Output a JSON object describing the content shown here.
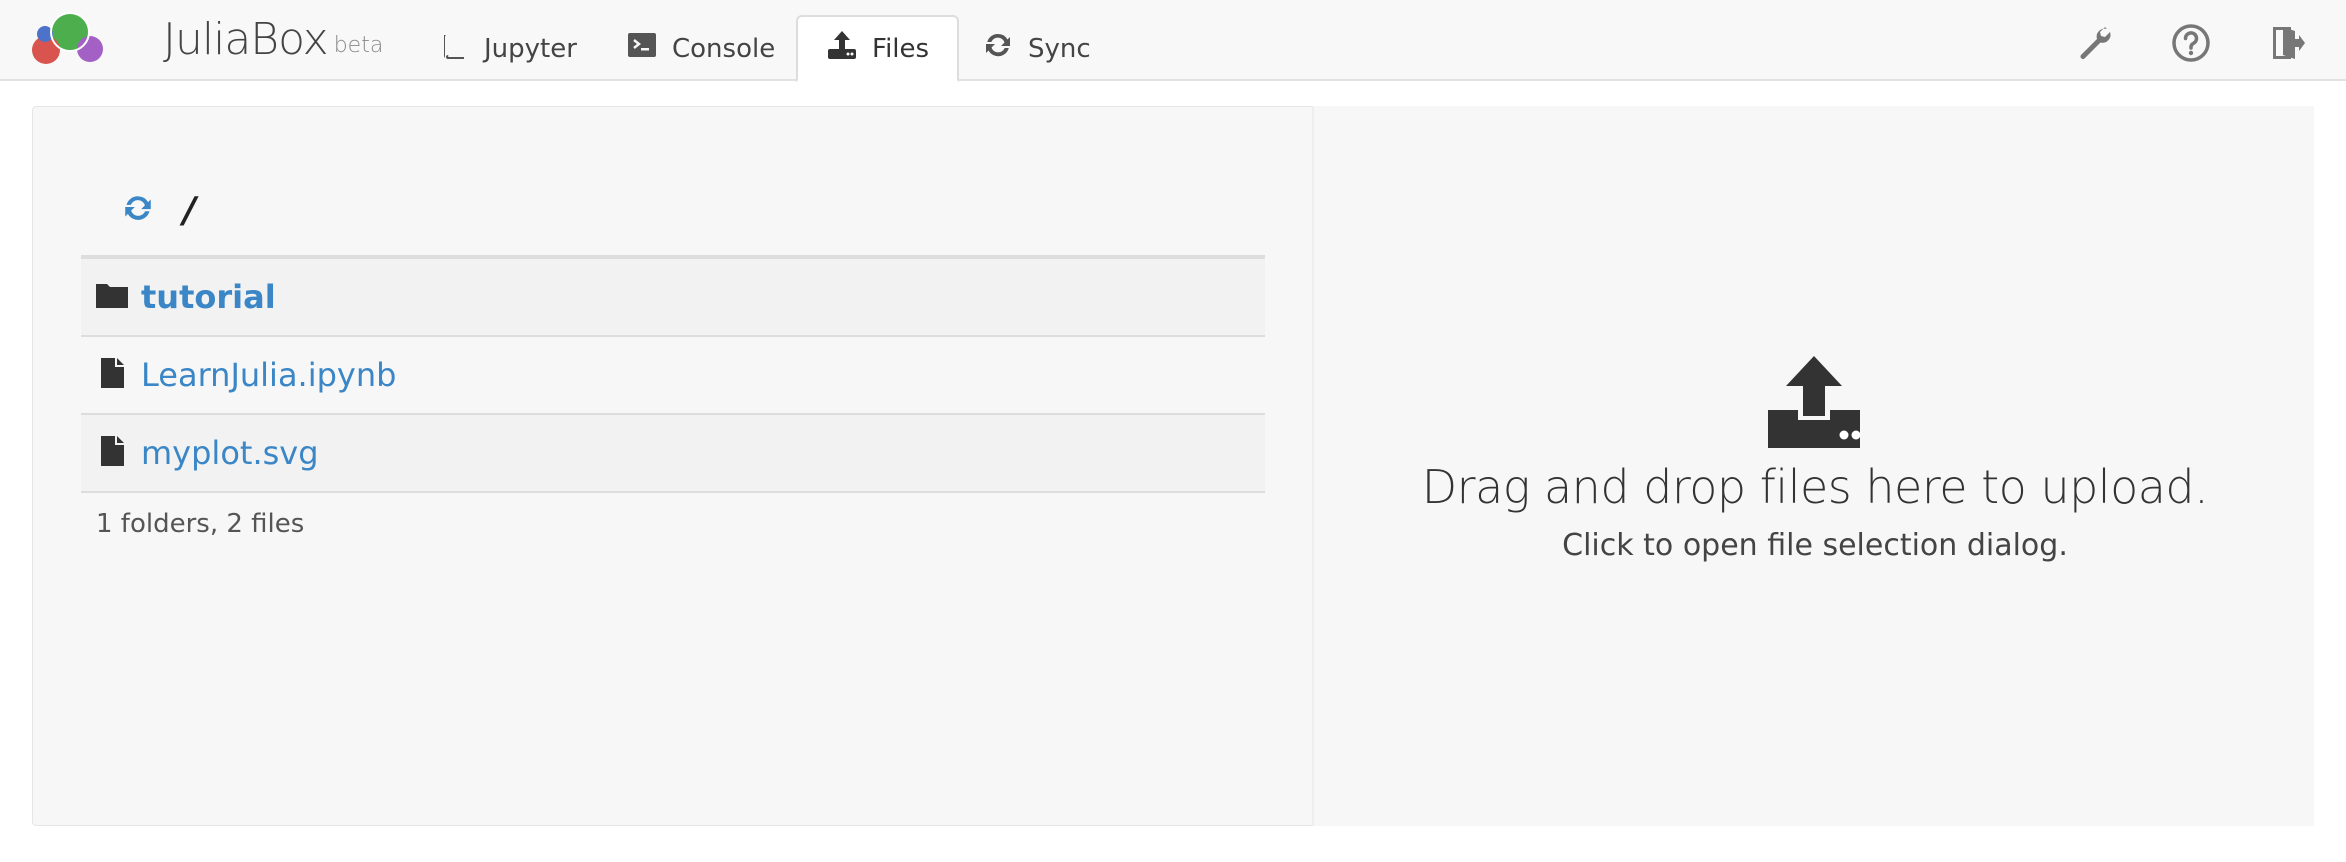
{
  "app": {
    "brand": "JuliaBox",
    "brand_sup": "beta"
  },
  "nav": {
    "tabs": [
      {
        "label": "Jupyter",
        "icon": "book-icon",
        "active": false
      },
      {
        "label": "Console",
        "icon": "terminal-icon",
        "active": false
      },
      {
        "label": "Files",
        "icon": "upload-icon",
        "active": true
      },
      {
        "label": "Sync",
        "icon": "refresh-icon",
        "active": false
      }
    ],
    "right_icons": [
      "wrench-icon",
      "help-icon",
      "sign-out-icon"
    ]
  },
  "files": {
    "path": "/",
    "rows": [
      {
        "name": "tutorial",
        "type": "folder"
      },
      {
        "name": "LearnJulia.ipynb",
        "type": "file"
      },
      {
        "name": "myplot.svg",
        "type": "file"
      }
    ],
    "summary": "1 folders, 2 files"
  },
  "upload": {
    "title": "Drag and drop files here to upload.",
    "subtitle": "Click to open file selection dialog."
  },
  "colors": {
    "link": "#3a86c6",
    "navbar_bg": "#f8f8f8",
    "panel_bg": "#f7f7f7",
    "logo_green": "#4cae4c",
    "logo_red": "#d9534f",
    "logo_purple": "#a461c5",
    "logo_blue": "#4d72c9"
  }
}
